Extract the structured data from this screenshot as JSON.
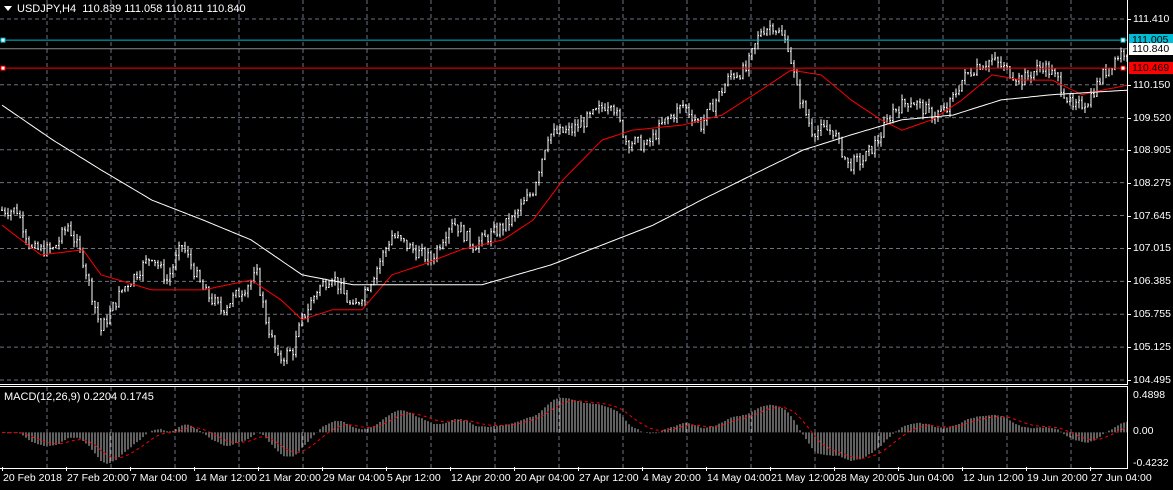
{
  "header": {
    "symbol": "USDJPY,H4",
    "open": "110.839",
    "high": "111.058",
    "low": "110.811",
    "close": "110.840"
  },
  "colors": {
    "bg": "#000000",
    "grid": "#6b7280",
    "bull": "#ffffff",
    "bear": "#ffffff",
    "ma_fast": "#ff0000",
    "ma_slow": "#ffffff",
    "hline_cyan": "#00bcd4",
    "hline_red": "#ff0000",
    "macd_hist": "#c0c0c0",
    "macd_signal": "#ff0000"
  },
  "price_axis": {
    "range": [
      104.495,
      111.41
    ],
    "labels": [
      "111.410",
      "110.150",
      "109.520",
      "108.905",
      "108.275",
      "107.645",
      "107.015",
      "106.385",
      "105.755",
      "105.125",
      "104.495"
    ]
  },
  "current_price": {
    "label": "110.840",
    "value": 110.84
  },
  "hlines": [
    {
      "label": "111.005",
      "value": 111.005,
      "color": "#00bcd4"
    },
    {
      "label": "110.469",
      "value": 110.469,
      "color": "#ff0000"
    }
  ],
  "macd": {
    "title": "MACD(12,26,9) 0.2204 0.1745",
    "labels": [
      "0.4898",
      "0.00",
      "-0.4232"
    ],
    "range": [
      -0.4232,
      0.4898
    ]
  },
  "time_axis": {
    "labels": [
      "20 Feb 2018",
      "27 Feb 20:00",
      "7 Mar 04:00",
      "14 Mar 12:00",
      "21 Mar 20:00",
      "29 Mar 04:00",
      "5 Apr 12:00",
      "12 Apr 20:00",
      "20 Apr 04:00",
      "27 Apr 12:00",
      "4 May 20:00",
      "14 May 04:00",
      "21 May 12:00",
      "28 May 20:00",
      "5 Jun 04:00",
      "12 Jun 12:00",
      "19 Jun 20:00",
      "27 Jun 04:00"
    ]
  },
  "price_path": [
    [
      0,
      107.75
    ],
    [
      5,
      107.75
    ],
    [
      10,
      106.99
    ],
    [
      17,
      106.99
    ],
    [
      22,
      107.46
    ],
    [
      27,
      106.8
    ],
    [
      33,
      105.45
    ],
    [
      40,
      106.22
    ],
    [
      50,
      106.89
    ],
    [
      55,
      106.41
    ],
    [
      60,
      107.08
    ],
    [
      67,
      106.22
    ],
    [
      73,
      105.84
    ],
    [
      80,
      106.22
    ],
    [
      85,
      106.51
    ],
    [
      88,
      105.65
    ],
    [
      92,
      104.88
    ],
    [
      97,
      105.07
    ],
    [
      100,
      105.65
    ],
    [
      105,
      106.22
    ],
    [
      110,
      106.51
    ],
    [
      117,
      105.84
    ],
    [
      123,
      106.41
    ],
    [
      130,
      107.27
    ],
    [
      137,
      106.99
    ],
    [
      143,
      106.8
    ],
    [
      150,
      107.56
    ],
    [
      157,
      107.08
    ],
    [
      163,
      107.27
    ],
    [
      170,
      107.56
    ],
    [
      177,
      108.13
    ],
    [
      182,
      109.19
    ],
    [
      190,
      109.28
    ],
    [
      197,
      109.57
    ],
    [
      203,
      109.86
    ],
    [
      208,
      109.09
    ],
    [
      215,
      108.98
    ],
    [
      220,
      109.38
    ],
    [
      227,
      109.76
    ],
    [
      233,
      109.38
    ],
    [
      238,
      109.86
    ],
    [
      243,
      110.34
    ],
    [
      248,
      110.43
    ],
    [
      253,
      111.2
    ],
    [
      257,
      111.3
    ],
    [
      262,
      110.91
    ],
    [
      265,
      110.05
    ],
    [
      270,
      109.28
    ],
    [
      277,
      109.28
    ],
    [
      282,
      108.61
    ],
    [
      287,
      108.71
    ],
    [
      292,
      109.09
    ],
    [
      297,
      109.67
    ],
    [
      303,
      109.86
    ],
    [
      310,
      109.57
    ],
    [
      315,
      109.67
    ],
    [
      320,
      110.24
    ],
    [
      325,
      110.53
    ],
    [
      330,
      110.62
    ],
    [
      335,
      110.43
    ],
    [
      340,
      110.24
    ],
    [
      347,
      110.53
    ],
    [
      352,
      110.24
    ],
    [
      357,
      109.67
    ],
    [
      362,
      109.86
    ],
    [
      367,
      110.34
    ],
    [
      372,
      110.72
    ],
    [
      376,
      110.87
    ]
  ],
  "ma_fast": [
    [
      0,
      107.46
    ],
    [
      13,
      106.89
    ],
    [
      27,
      106.99
    ],
    [
      33,
      106.51
    ],
    [
      50,
      106.22
    ],
    [
      67,
      106.22
    ],
    [
      83,
      106.41
    ],
    [
      93,
      106.03
    ],
    [
      100,
      105.65
    ],
    [
      110,
      105.84
    ],
    [
      120,
      105.84
    ],
    [
      130,
      106.51
    ],
    [
      140,
      106.7
    ],
    [
      153,
      106.99
    ],
    [
      167,
      107.18
    ],
    [
      177,
      107.56
    ],
    [
      187,
      108.33
    ],
    [
      200,
      109.09
    ],
    [
      210,
      109.28
    ],
    [
      227,
      109.38
    ],
    [
      240,
      109.57
    ],
    [
      253,
      110.05
    ],
    [
      263,
      110.43
    ],
    [
      273,
      110.34
    ],
    [
      283,
      109.86
    ],
    [
      293,
      109.48
    ],
    [
      300,
      109.28
    ],
    [
      310,
      109.48
    ],
    [
      320,
      109.86
    ],
    [
      330,
      110.34
    ],
    [
      340,
      110.24
    ],
    [
      350,
      110.24
    ],
    [
      360,
      109.96
    ],
    [
      367,
      110.05
    ],
    [
      376,
      110.15
    ]
  ],
  "ma_slow": [
    [
      0,
      109.76
    ],
    [
      17,
      109.09
    ],
    [
      33,
      108.52
    ],
    [
      50,
      107.94
    ],
    [
      67,
      107.56
    ],
    [
      83,
      107.18
    ],
    [
      100,
      106.51
    ],
    [
      117,
      106.32
    ],
    [
      133,
      106.32
    ],
    [
      160,
      106.32
    ],
    [
      183,
      106.7
    ],
    [
      200,
      107.08
    ],
    [
      217,
      107.46
    ],
    [
      233,
      107.94
    ],
    [
      250,
      108.42
    ],
    [
      267,
      108.9
    ],
    [
      283,
      109.19
    ],
    [
      300,
      109.48
    ],
    [
      317,
      109.57
    ],
    [
      333,
      109.86
    ],
    [
      350,
      109.96
    ],
    [
      376,
      110.05
    ]
  ]
}
